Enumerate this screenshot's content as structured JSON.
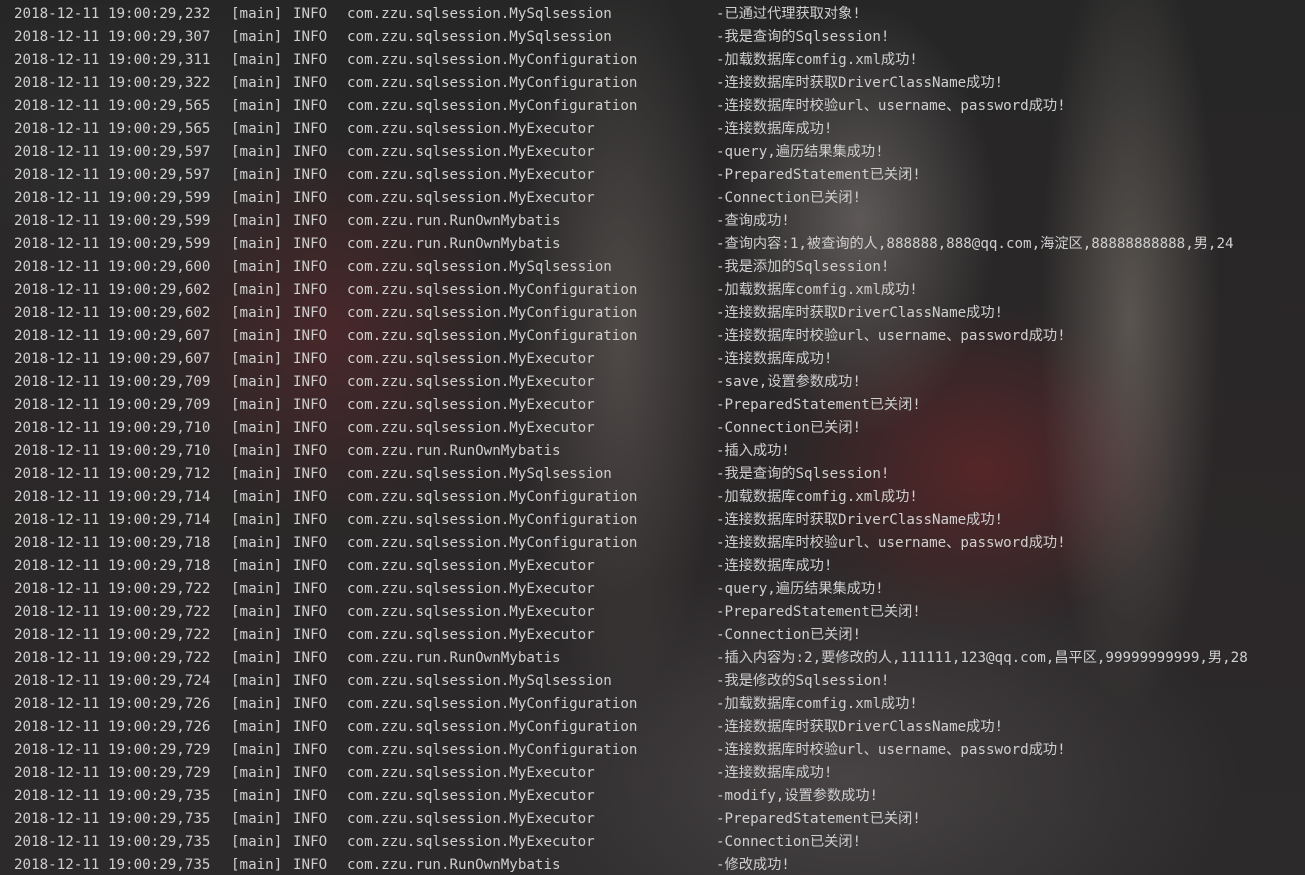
{
  "console": {
    "lines": [
      {
        "timestamp": "2018-12-11 19:00:29,232",
        "thread": "[main]",
        "level": "INFO",
        "logger": "com.zzu.sqlsession.MySqlsession",
        "message": "-已通过代理获取对象!"
      },
      {
        "timestamp": "2018-12-11 19:00:29,307",
        "thread": "[main]",
        "level": "INFO",
        "logger": "com.zzu.sqlsession.MySqlsession",
        "message": "-我是查询的Sqlsession!"
      },
      {
        "timestamp": "2018-12-11 19:00:29,311",
        "thread": "[main]",
        "level": "INFO",
        "logger": "com.zzu.sqlsession.MyConfiguration",
        "message": "-加载数据库comfig.xml成功!"
      },
      {
        "timestamp": "2018-12-11 19:00:29,322",
        "thread": "[main]",
        "level": "INFO",
        "logger": "com.zzu.sqlsession.MyConfiguration",
        "message": "-连接数据库时获取DriverClassName成功!"
      },
      {
        "timestamp": "2018-12-11 19:00:29,565",
        "thread": "[main]",
        "level": "INFO",
        "logger": "com.zzu.sqlsession.MyConfiguration",
        "message": "-连接数据库时校验url、username、password成功!"
      },
      {
        "timestamp": "2018-12-11 19:00:29,565",
        "thread": "[main]",
        "level": "INFO",
        "logger": "com.zzu.sqlsession.MyExecutor",
        "message": "-连接数据库成功!"
      },
      {
        "timestamp": "2018-12-11 19:00:29,597",
        "thread": "[main]",
        "level": "INFO",
        "logger": "com.zzu.sqlsession.MyExecutor",
        "message": "-query,遍历结果集成功!"
      },
      {
        "timestamp": "2018-12-11 19:00:29,597",
        "thread": "[main]",
        "level": "INFO",
        "logger": "com.zzu.sqlsession.MyExecutor",
        "message": "-PreparedStatement已关闭!"
      },
      {
        "timestamp": "2018-12-11 19:00:29,599",
        "thread": "[main]",
        "level": "INFO",
        "logger": "com.zzu.sqlsession.MyExecutor",
        "message": "-Connection已关闭!"
      },
      {
        "timestamp": "2018-12-11 19:00:29,599",
        "thread": "[main]",
        "level": "INFO",
        "logger": "com.zzu.run.RunOwnMybatis",
        "message": "-查询成功!"
      },
      {
        "timestamp": "2018-12-11 19:00:29,599",
        "thread": "[main]",
        "level": "INFO",
        "logger": "com.zzu.run.RunOwnMybatis",
        "message": "-查询内容:1,被查询的人,888888,888@qq.com,海淀区,88888888888,男,24"
      },
      {
        "timestamp": "2018-12-11 19:00:29,600",
        "thread": "[main]",
        "level": "INFO",
        "logger": "com.zzu.sqlsession.MySqlsession",
        "message": "-我是添加的Sqlsession!"
      },
      {
        "timestamp": "2018-12-11 19:00:29,602",
        "thread": "[main]",
        "level": "INFO",
        "logger": "com.zzu.sqlsession.MyConfiguration",
        "message": "-加载数据库comfig.xml成功!"
      },
      {
        "timestamp": "2018-12-11 19:00:29,602",
        "thread": "[main]",
        "level": "INFO",
        "logger": "com.zzu.sqlsession.MyConfiguration",
        "message": "-连接数据库时获取DriverClassName成功!"
      },
      {
        "timestamp": "2018-12-11 19:00:29,607",
        "thread": "[main]",
        "level": "INFO",
        "logger": "com.zzu.sqlsession.MyConfiguration",
        "message": "-连接数据库时校验url、username、password成功!"
      },
      {
        "timestamp": "2018-12-11 19:00:29,607",
        "thread": "[main]",
        "level": "INFO",
        "logger": "com.zzu.sqlsession.MyExecutor",
        "message": "-连接数据库成功!"
      },
      {
        "timestamp": "2018-12-11 19:00:29,709",
        "thread": "[main]",
        "level": "INFO",
        "logger": "com.zzu.sqlsession.MyExecutor",
        "message": "-save,设置参数成功!"
      },
      {
        "timestamp": "2018-12-11 19:00:29,709",
        "thread": "[main]",
        "level": "INFO",
        "logger": "com.zzu.sqlsession.MyExecutor",
        "message": "-PreparedStatement已关闭!"
      },
      {
        "timestamp": "2018-12-11 19:00:29,710",
        "thread": "[main]",
        "level": "INFO",
        "logger": "com.zzu.sqlsession.MyExecutor",
        "message": "-Connection已关闭!"
      },
      {
        "timestamp": "2018-12-11 19:00:29,710",
        "thread": "[main]",
        "level": "INFO",
        "logger": "com.zzu.run.RunOwnMybatis",
        "message": "-插入成功!"
      },
      {
        "timestamp": "2018-12-11 19:00:29,712",
        "thread": "[main]",
        "level": "INFO",
        "logger": "com.zzu.sqlsession.MySqlsession",
        "message": "-我是查询的Sqlsession!"
      },
      {
        "timestamp": "2018-12-11 19:00:29,714",
        "thread": "[main]",
        "level": "INFO",
        "logger": "com.zzu.sqlsession.MyConfiguration",
        "message": "-加载数据库comfig.xml成功!"
      },
      {
        "timestamp": "2018-12-11 19:00:29,714",
        "thread": "[main]",
        "level": "INFO",
        "logger": "com.zzu.sqlsession.MyConfiguration",
        "message": "-连接数据库时获取DriverClassName成功!"
      },
      {
        "timestamp": "2018-12-11 19:00:29,718",
        "thread": "[main]",
        "level": "INFO",
        "logger": "com.zzu.sqlsession.MyConfiguration",
        "message": "-连接数据库时校验url、username、password成功!"
      },
      {
        "timestamp": "2018-12-11 19:00:29,718",
        "thread": "[main]",
        "level": "INFO",
        "logger": "com.zzu.sqlsession.MyExecutor",
        "message": "-连接数据库成功!"
      },
      {
        "timestamp": "2018-12-11 19:00:29,722",
        "thread": "[main]",
        "level": "INFO",
        "logger": "com.zzu.sqlsession.MyExecutor",
        "message": "-query,遍历结果集成功!"
      },
      {
        "timestamp": "2018-12-11 19:00:29,722",
        "thread": "[main]",
        "level": "INFO",
        "logger": "com.zzu.sqlsession.MyExecutor",
        "message": "-PreparedStatement已关闭!"
      },
      {
        "timestamp": "2018-12-11 19:00:29,722",
        "thread": "[main]",
        "level": "INFO",
        "logger": "com.zzu.sqlsession.MyExecutor",
        "message": "-Connection已关闭!"
      },
      {
        "timestamp": "2018-12-11 19:00:29,722",
        "thread": "[main]",
        "level": "INFO",
        "logger": "com.zzu.run.RunOwnMybatis",
        "message": "-插入内容为:2,要修改的人,111111,123@qq.com,昌平区,99999999999,男,28"
      },
      {
        "timestamp": "2018-12-11 19:00:29,724",
        "thread": "[main]",
        "level": "INFO",
        "logger": "com.zzu.sqlsession.MySqlsession",
        "message": "-我是修改的Sqlsession!"
      },
      {
        "timestamp": "2018-12-11 19:00:29,726",
        "thread": "[main]",
        "level": "INFO",
        "logger": "com.zzu.sqlsession.MyConfiguration",
        "message": "-加载数据库comfig.xml成功!"
      },
      {
        "timestamp": "2018-12-11 19:00:29,726",
        "thread": "[main]",
        "level": "INFO",
        "logger": "com.zzu.sqlsession.MyConfiguration",
        "message": "-连接数据库时获取DriverClassName成功!"
      },
      {
        "timestamp": "2018-12-11 19:00:29,729",
        "thread": "[main]",
        "level": "INFO",
        "logger": "com.zzu.sqlsession.MyConfiguration",
        "message": "-连接数据库时校验url、username、password成功!"
      },
      {
        "timestamp": "2018-12-11 19:00:29,729",
        "thread": "[main]",
        "level": "INFO",
        "logger": "com.zzu.sqlsession.MyExecutor",
        "message": "-连接数据库成功!"
      },
      {
        "timestamp": "2018-12-11 19:00:29,735",
        "thread": "[main]",
        "level": "INFO",
        "logger": "com.zzu.sqlsession.MyExecutor",
        "message": "-modify,设置参数成功!"
      },
      {
        "timestamp": "2018-12-11 19:00:29,735",
        "thread": "[main]",
        "level": "INFO",
        "logger": "com.zzu.sqlsession.MyExecutor",
        "message": "-PreparedStatement已关闭!"
      },
      {
        "timestamp": "2018-12-11 19:00:29,735",
        "thread": "[main]",
        "level": "INFO",
        "logger": "com.zzu.sqlsession.MyExecutor",
        "message": "-Connection已关闭!"
      },
      {
        "timestamp": "2018-12-11 19:00:29,735",
        "thread": "[main]",
        "level": "INFO",
        "logger": "com.zzu.run.RunOwnMybatis",
        "message": "-修改成功!"
      }
    ]
  }
}
